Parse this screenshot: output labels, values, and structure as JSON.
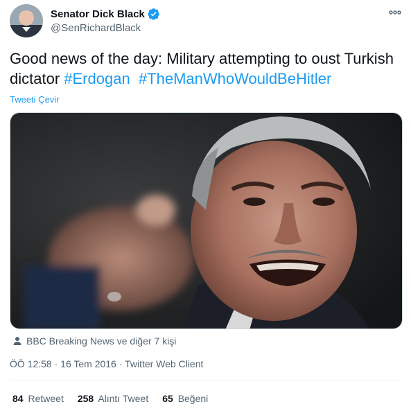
{
  "author": {
    "name": "Senator Dick Black",
    "handle": "@SenRichardBlack"
  },
  "tweet": {
    "text_plain": "Good news of the day: Military attempting to oust Turkish dictator ",
    "hashtags": [
      "#Erdogan",
      "#TheManWhoWouldBeHitler"
    ],
    "translate_label": "Tweeti Çevir"
  },
  "tagged": "BBC Breaking News ve diğer 7 kişi",
  "meta": {
    "time": "ÖÖ 12:58",
    "date": "16 Tem 2016",
    "client": "Twitter Web Client"
  },
  "stats": {
    "retweets": "84",
    "retweets_label": "Retweet",
    "quotes": "258",
    "quotes_label": "Alıntı Tweet",
    "likes": "65",
    "likes_label": "Beğeni"
  },
  "colors": {
    "accent": "#1d9bf0",
    "secondary_text": "#536471",
    "primary_text": "#0f1419"
  }
}
